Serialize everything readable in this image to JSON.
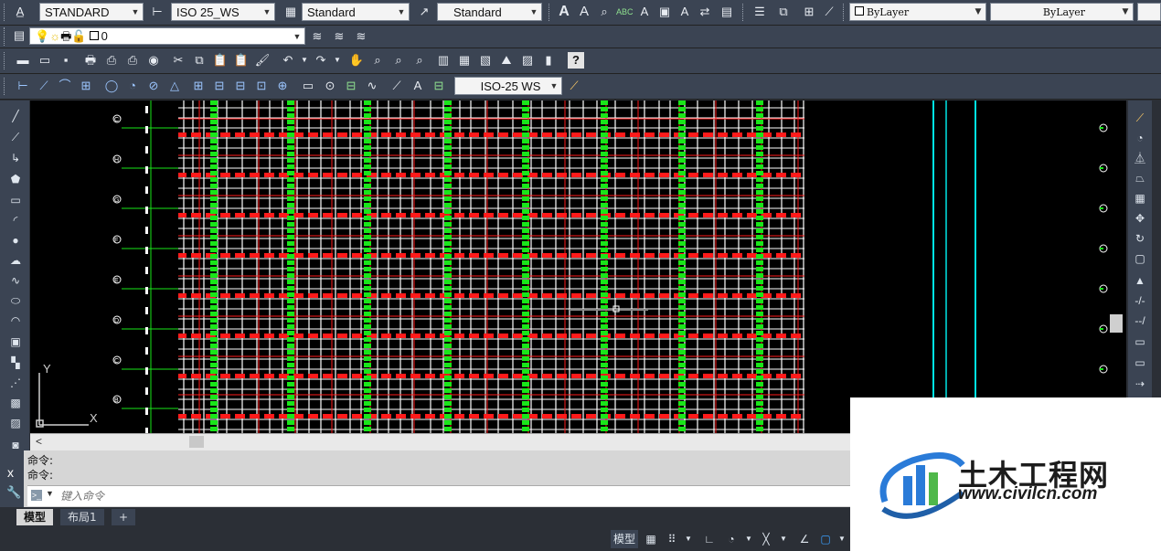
{
  "toolbar_row1": {
    "text_style": "STANDARD",
    "dim_style": "ISO 25_WS",
    "table_style": "Standard",
    "mleader_style": "Standard",
    "color": "ByLayer",
    "linetype": "ByLayer"
  },
  "toolbar_row2": {
    "layer_name": "0"
  },
  "toolbar_row4": {
    "dim_style": "ISO-25 WS"
  },
  "canvas": {
    "ucs_y": "Y",
    "ucs_x": "X",
    "grid_labels_left": [
      "C",
      "H",
      "G",
      "F",
      "E",
      "D",
      "C",
      "B"
    ],
    "accent_colors": {
      "green": "#19e619",
      "red": "#ff1a1a",
      "cyan": "#00e5e5",
      "white": "#ffffff"
    }
  },
  "hscroll": {
    "left_arrow": "<"
  },
  "command": {
    "history_line1": "命令:",
    "history_line2": "命令:",
    "placeholder": "键入命令",
    "close_glyph": "x"
  },
  "tabs": {
    "model": "模型",
    "layout1": "布局1",
    "add": "+"
  },
  "status": {
    "model_label": "模型"
  },
  "logo": {
    "title": "土木工程网",
    "url": "www.civilcn.com"
  }
}
